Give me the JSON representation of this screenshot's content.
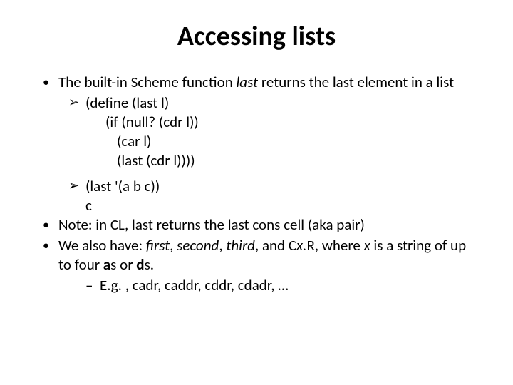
{
  "title": "Accessing lists",
  "bullet1": {
    "pre": "The built-in Scheme function ",
    "italic": "last",
    "post": " returns the last element in a list"
  },
  "code_def": {
    "line1": "(define (last l)",
    "line2": "(if (null? (cdr l))",
    "line3": "(car l)",
    "line4": "(last (cdr l))))"
  },
  "example": {
    "call": "(last  '(a  b  c))",
    "result": "c"
  },
  "bullet2": "Note: in CL, last returns the last cons cell (aka pair)",
  "bullet3": {
    "pre": "We also have: ",
    "i1": "first",
    "s1": ", ",
    "i2": "second",
    "s2": ", ",
    "i3": "third",
    "s3": ", and C",
    "i4": "x.",
    "s4": "R, where ",
    "i5": "x",
    "s5": " is a string of up to four ",
    "b1": "a",
    "s6": "s or ",
    "b2": "d",
    "s7": "s."
  },
  "subbullet": "E.g. , cadr, caddr, cddr, cdadr, …"
}
